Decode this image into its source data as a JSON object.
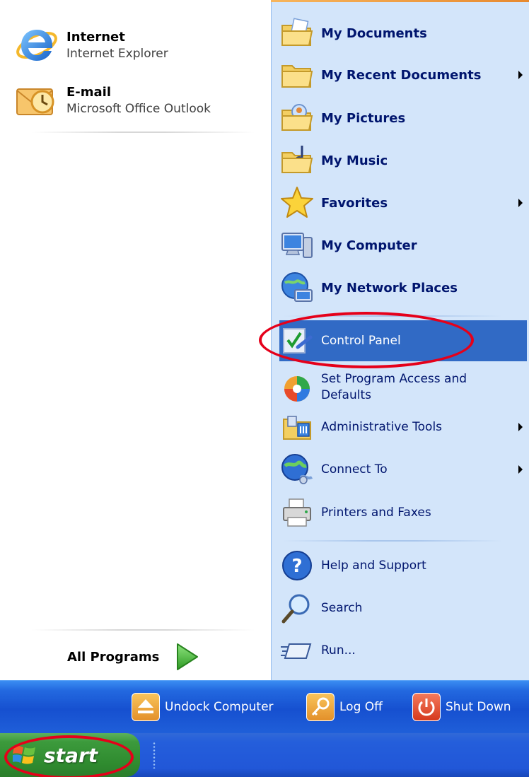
{
  "pinned": [
    {
      "title": "Internet",
      "subtitle": "Internet Explorer",
      "icon": "internet-explorer-icon"
    },
    {
      "title": "E-mail",
      "subtitle": "Microsoft Office Outlook",
      "icon": "outlook-icon"
    }
  ],
  "all_programs_label": "All Programs",
  "places": [
    {
      "label": "My Documents",
      "icon": "my-documents-icon",
      "submenu": false
    },
    {
      "label": "My Recent Documents",
      "icon": "recent-documents-icon",
      "submenu": true
    },
    {
      "label": "My Pictures",
      "icon": "my-pictures-icon",
      "submenu": false
    },
    {
      "label": "My Music",
      "icon": "my-music-icon",
      "submenu": false
    },
    {
      "label": "Favorites",
      "icon": "favorites-star-icon",
      "submenu": true
    },
    {
      "label": "My Computer",
      "icon": "my-computer-icon",
      "submenu": false
    },
    {
      "label": "My Network Places",
      "icon": "network-places-icon",
      "submenu": false
    }
  ],
  "settings": [
    {
      "label": "Control Panel",
      "icon": "control-panel-icon",
      "submenu": false,
      "selected": true
    },
    {
      "label": "Set Program Access and Defaults",
      "line1": "Set Program Access and",
      "line2": "Defaults",
      "icon": "program-access-icon",
      "submenu": false
    },
    {
      "label": "Administrative Tools",
      "icon": "admin-tools-icon",
      "submenu": true
    },
    {
      "label": "Connect To",
      "icon": "connect-to-icon",
      "submenu": true
    },
    {
      "label": "Printers and Faxes",
      "icon": "printer-icon",
      "submenu": false
    }
  ],
  "help": [
    {
      "label": "Help and Support",
      "icon": "help-icon"
    },
    {
      "label": "Search",
      "icon": "search-icon"
    },
    {
      "label": "Run...",
      "icon": "run-icon"
    }
  ],
  "bottom_bar": {
    "undock": "Undock Computer",
    "logoff": "Log Off",
    "shutdown": "Shut Down"
  },
  "taskbar": {
    "start_label": "start"
  },
  "colors": {
    "menu_right_bg": "#d3e5fa",
    "selection": "#316ac5",
    "annotation_red": "#e5001a",
    "start_green": "#3c9a3c"
  }
}
